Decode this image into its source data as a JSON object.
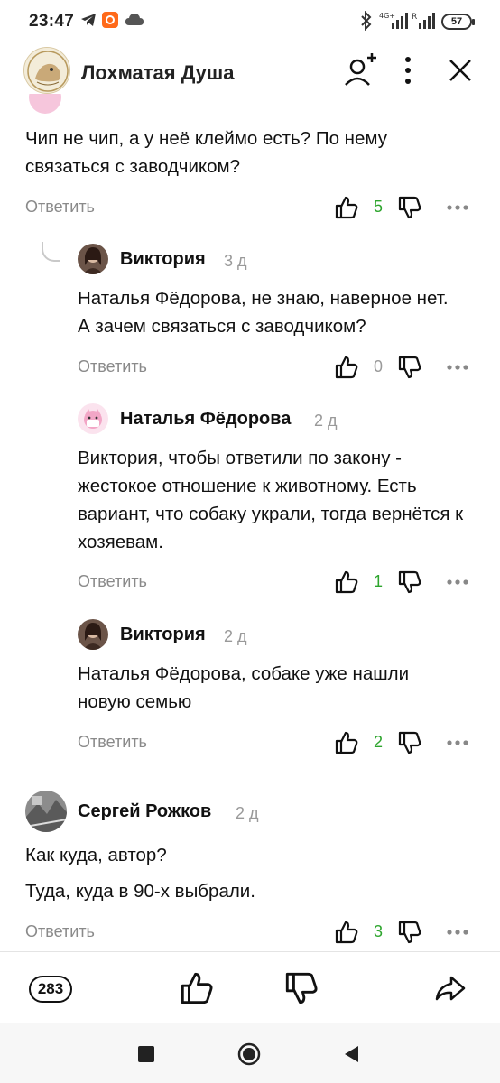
{
  "status_bar": {
    "time": "23:47",
    "battery": "57",
    "icons": [
      "telegram-icon",
      "app-notification-icon",
      "cloud-icon",
      "bluetooth-icon",
      "signal-4g-icon",
      "signal-r-icon",
      "battery-icon"
    ]
  },
  "header": {
    "channel_name": "Лохматая Душа",
    "icons": [
      "channel-avatar",
      "subscribe-icon",
      "more-vertical-icon",
      "close-icon"
    ]
  },
  "comments": [
    {
      "text": "Чип не чип, а у неё клеймо есть? По нему связаться с заводчиком?",
      "reply_label": "Ответить",
      "likes": "5",
      "likes_color": "#2ea52e"
    },
    {
      "author": "Виктория",
      "age": "3 д",
      "text": "Наталья Фёдорова, не знаю, наверное нет. А зачем связаться с заводчиком?",
      "reply_label": "Ответить",
      "likes": "0",
      "likes_color": "#9a9a9a"
    },
    {
      "author": "Наталья Фёдорова",
      "age": "2 д",
      "text": "Виктория, чтобы ответили по закону - жестокое отношение к животному. Есть вариант, что собаку украли, тогда вернётся к хозяевам.",
      "reply_label": "Ответить",
      "likes": "1",
      "likes_color": "#2ea52e"
    },
    {
      "author": "Виктория",
      "age": "2 д",
      "text": "Наталья Фёдорова, собаке уже нашли новую семью",
      "reply_label": "Ответить",
      "likes": "2",
      "likes_color": "#2ea52e"
    },
    {
      "author": "Сергей Рожков",
      "age": "2 д",
      "text_line1": "Как куда, автор?",
      "text_line2": "Туда, куда в 90-х выбрали.",
      "reply_label": "Ответить",
      "likes": "3",
      "likes_color": "#2ea52e"
    }
  ],
  "bottom_bar": {
    "comments_count": "283",
    "icons": [
      "comments-icon",
      "like-icon",
      "dislike-icon",
      "share-icon"
    ]
  },
  "nav_bar": {
    "icons": [
      "recent-apps-icon",
      "home-icon",
      "back-icon"
    ]
  },
  "colors": {
    "accent_green": "#2ea52e",
    "muted_gray": "#8a8a8a"
  }
}
